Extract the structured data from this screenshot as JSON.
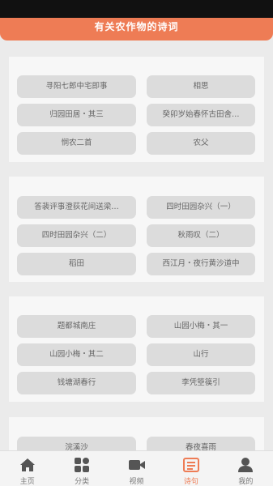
{
  "header": {
    "title": "有关农作物的诗词"
  },
  "sections": [
    {
      "items": [
        "寻阳七郎中宅即事",
        "相思",
        "归园田居・其三",
        "癸卯岁始春怀古田舍…",
        "悯农二首",
        "农父"
      ]
    },
    {
      "items": [
        "答裴评事澄荻花间送梁…",
        "四时田园杂兴（一）",
        "四时田园杂兴（二）",
        "秋雨叹（二）",
        "稻田",
        "西江月・夜行黄沙道中"
      ]
    },
    {
      "items": [
        "题都城南庄",
        "山园小梅・其一",
        "山园小梅・其二",
        "山行",
        "钱塘湖春行",
        "李凭箜篌引"
      ]
    },
    {
      "items": [
        "浣溪沙",
        "春夜喜雨"
      ]
    }
  ],
  "tabs": [
    {
      "label": "主页",
      "icon": "home-icon"
    },
    {
      "label": "分类",
      "icon": "grid-icon"
    },
    {
      "label": "视频",
      "icon": "video-icon"
    },
    {
      "label": "诗句",
      "icon": "poem-icon",
      "active": true
    },
    {
      "label": "我的",
      "icon": "user-icon"
    }
  ],
  "colors": {
    "accent": "#ee7c55",
    "card": "#f7f7f7",
    "item": "#dcdcdc",
    "background": "#ebebeb"
  }
}
